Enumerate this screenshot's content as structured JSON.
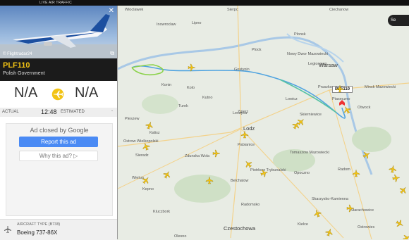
{
  "topbar": {
    "brand": "LIVE AIR TRAFFIC"
  },
  "photo": {
    "credit": "© Flightradar24",
    "close": "✕",
    "external": "⧉"
  },
  "flight": {
    "callsign": "PLF110",
    "operator": "Polish Government"
  },
  "route": {
    "origin": "N/A",
    "destination": "N/A"
  },
  "times": {
    "actual_label": "ACTUAL",
    "actual_value": "12:48",
    "estimated_label": "ESTIMATED",
    "estimated_value": "-"
  },
  "ad": {
    "closed_text": "Ad closed by Google",
    "report_label": "Report this ad",
    "why_label": "Why this ad? ▷"
  },
  "aircraft": {
    "label": "AIRCRAFT TYPE",
    "code": "(B738)",
    "model": "Boeing 737-86X"
  },
  "map": {
    "search_label": "Se",
    "flight_tag": "PLF110",
    "cities": [
      {
        "name": "Wloclawek",
        "big": false
      },
      {
        "name": "Sierpc",
        "big": false
      },
      {
        "name": "Ciechanow",
        "big": false
      },
      {
        "name": "Inowroclaw",
        "big": false
      },
      {
        "name": "Lipno",
        "big": false
      },
      {
        "name": "Plonsk",
        "big": false
      },
      {
        "name": "Nowy Dwor Mazowiecki",
        "big": false
      },
      {
        "name": "Plock",
        "big": false
      },
      {
        "name": "Legionowo",
        "big": false
      },
      {
        "name": "Gostynin",
        "big": false
      },
      {
        "name": "Warsaw",
        "big": true
      },
      {
        "name": "Konin",
        "big": false
      },
      {
        "name": "Kolo",
        "big": false
      },
      {
        "name": "Kutno",
        "big": false
      },
      {
        "name": "Lowicz",
        "big": false
      },
      {
        "name": "Pruszkow",
        "big": false
      },
      {
        "name": "Piaseczno",
        "big": false
      },
      {
        "name": "Minsk Mazowiecki",
        "big": false
      },
      {
        "name": "Otwock",
        "big": false
      },
      {
        "name": "Turek",
        "big": false
      },
      {
        "name": "Leczyca",
        "big": false
      },
      {
        "name": "Skierniewice",
        "big": false
      },
      {
        "name": "Zgierz",
        "big": false
      },
      {
        "name": "Lodz",
        "big": true
      },
      {
        "name": "Pleszew",
        "big": false
      },
      {
        "name": "Kalisz",
        "big": false
      },
      {
        "name": "Sieradz",
        "big": false
      },
      {
        "name": "Pabianice",
        "big": false
      },
      {
        "name": "Tomaszow Mazowiecki",
        "big": false
      },
      {
        "name": "Ostrow Wielkopolski",
        "big": false
      },
      {
        "name": "Zdunska Wola",
        "big": false
      },
      {
        "name": "Piotrkow Trybunalski",
        "big": false
      },
      {
        "name": "Opoczno",
        "big": false
      },
      {
        "name": "Radom",
        "big": false
      },
      {
        "name": "Wielun",
        "big": false
      },
      {
        "name": "Belchatow",
        "big": false
      },
      {
        "name": "Kepno",
        "big": false
      },
      {
        "name": "Radomsko",
        "big": false
      },
      {
        "name": "Skarzysko-Kamienna",
        "big": false
      },
      {
        "name": "Starachowice",
        "big": false
      },
      {
        "name": "Kluczbork",
        "big": false
      },
      {
        "name": "Czestochowa",
        "big": true
      },
      {
        "name": "Kielce",
        "big": false
      },
      {
        "name": "Ostrowiec",
        "big": false
      },
      {
        "name": "Olesno",
        "big": false
      }
    ]
  },
  "colors": {
    "accent": "#f2c314",
    "button": "#4a8af4",
    "header": "#1b1b1b"
  }
}
